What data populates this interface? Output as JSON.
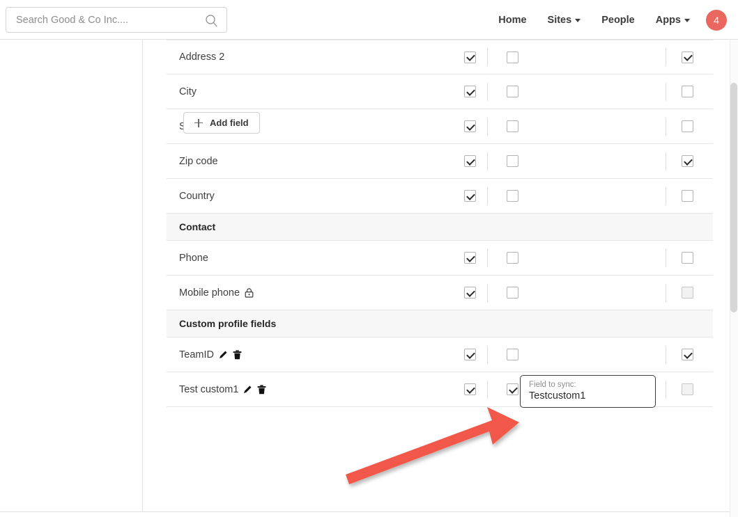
{
  "header": {
    "search": {
      "placeholder": "Search Good & Co Inc....",
      "value": "",
      "icon": "search-icon"
    },
    "nav": [
      {
        "label": "Home",
        "has_caret": false
      },
      {
        "label": "Sites",
        "has_caret": true
      },
      {
        "label": "People",
        "has_caret": false
      },
      {
        "label": "Apps",
        "has_caret": true
      }
    ],
    "badge": {
      "count": "4",
      "color": "#e8685f"
    }
  },
  "table": {
    "rows": [
      {
        "type": "field",
        "label": "Address 2",
        "icons": [],
        "checks": [
          "checked",
          "unchecked",
          "checked"
        ],
        "sync": null
      },
      {
        "type": "field",
        "label": "City",
        "icons": [],
        "checks": [
          "checked",
          "unchecked",
          "unchecked"
        ],
        "sync": null
      },
      {
        "type": "field",
        "label": "State/Province",
        "icons": [],
        "checks": [
          "checked",
          "unchecked",
          "unchecked"
        ],
        "sync": null
      },
      {
        "type": "field",
        "label": "Zip code",
        "icons": [],
        "checks": [
          "checked",
          "unchecked",
          "checked"
        ],
        "sync": null
      },
      {
        "type": "field",
        "label": "Country",
        "icons": [],
        "checks": [
          "checked",
          "unchecked",
          "unchecked"
        ],
        "sync": null
      },
      {
        "type": "section",
        "label": "Contact",
        "icons": [],
        "checks": [],
        "sync": null
      },
      {
        "type": "field",
        "label": "Phone",
        "icons": [],
        "checks": [
          "checked",
          "unchecked",
          "unchecked"
        ],
        "sync": null
      },
      {
        "type": "field",
        "label": "Mobile phone",
        "icons": [
          "lock-icon"
        ],
        "checks": [
          "checked",
          "unchecked",
          "disabled"
        ],
        "sync": null
      },
      {
        "type": "section",
        "label": "Custom profile fields",
        "icons": [],
        "checks": [],
        "sync": null
      },
      {
        "type": "field",
        "label": "TeamID",
        "icons": [
          "edit-pencil-icon",
          "delete-trash-icon"
        ],
        "checks": [
          "checked",
          "unchecked",
          "checked"
        ],
        "sync": null
      },
      {
        "type": "field",
        "label": "Test custom1",
        "icons": [
          "edit-pencil-icon",
          "delete-trash-icon"
        ],
        "checks": [
          "checked",
          "checked",
          "disabled"
        ],
        "sync": {
          "label": "Field to sync:",
          "value": "Testcustom1"
        }
      }
    ]
  },
  "add_field_button": {
    "label": "Add field",
    "icon": "plus-icon"
  },
  "annotation": {
    "arrow": {
      "color": "#f2584a",
      "description": "red-arrow-pointing-to-sync-checkbox"
    }
  }
}
